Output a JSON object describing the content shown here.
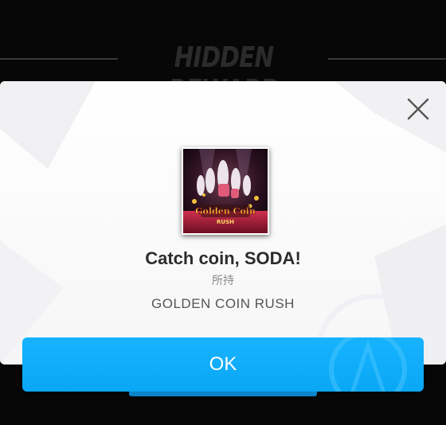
{
  "header": {
    "title": "HIDDEN REWARD"
  },
  "modal": {
    "close_icon": "close-icon",
    "jacket": {
      "art_title": "Golden Coin",
      "art_subtitle": "RUSH"
    },
    "song_title": "Catch coin, SODA!",
    "owned_label": "所持",
    "reward_name": "GOLDEN COIN RUSH"
  },
  "ok_button": {
    "label": "OK"
  },
  "colors": {
    "background": "#060606",
    "modal_background": "#ffffff",
    "accent": "#0aa7f5",
    "title_text": "#2c2c2c",
    "secondary_text": "#8a8a8a"
  }
}
